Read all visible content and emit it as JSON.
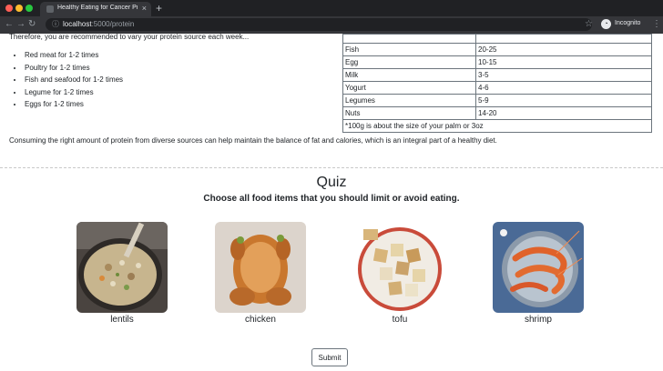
{
  "browser": {
    "tab_title": "Healthy Eating for Cancer Prev",
    "url_host": "localhost",
    "url_path": ":5000/protein",
    "profile_label": "Incognito"
  },
  "page": {
    "intro": "Therefore, you are recommended to vary your protein source each week...",
    "frequency_list": [
      "Red meat for 1-2 times",
      "Poultry for 1-2 times",
      "Fish and seafood for 1-2 times",
      "Legume for 1-2 times",
      "Eggs for 1-2 times"
    ],
    "table_rows": [
      [
        "Fish",
        "20-25"
      ],
      [
        "Egg",
        "10-15"
      ],
      [
        "Milk",
        "3-5"
      ],
      [
        "Yogurt",
        "4-6"
      ],
      [
        "Legumes",
        "5-9"
      ],
      [
        "Nuts",
        "14-20"
      ]
    ],
    "table_note": "*100g is about the size of your palm or 3oz",
    "summary": "Consuming the right amount of protein from diverse sources can help maintain the balance of fat and calories, which is an integral part of a healthy diet."
  },
  "quiz": {
    "title": "Quiz",
    "prompt": "Choose all food items that you should limit or avoid eating.",
    "items": [
      {
        "label": "lentils"
      },
      {
        "label": "chicken"
      },
      {
        "label": "tofu"
      },
      {
        "label": "shrimp"
      }
    ],
    "submit_label": "Submit"
  }
}
